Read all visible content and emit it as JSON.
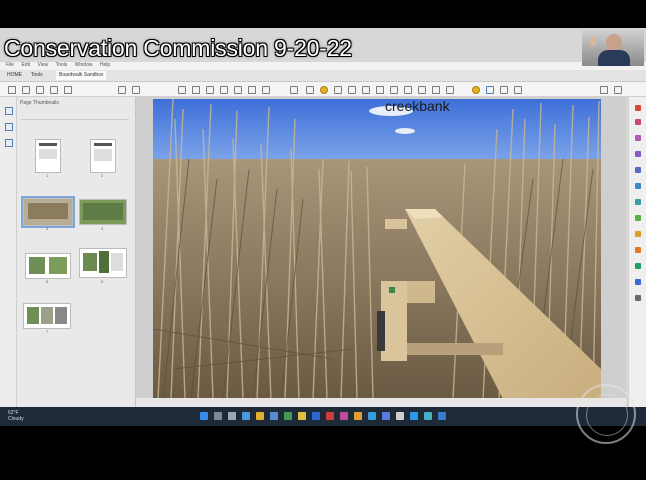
{
  "meeting": {
    "title": "Conservation Commission 9-20-22"
  },
  "app": {
    "menu": [
      "File",
      "Edit",
      "View",
      "Tools",
      "Window",
      "Help"
    ],
    "tabs": [
      {
        "label": "HOME",
        "active": false
      },
      {
        "label": "Tools",
        "active": false
      },
      {
        "label": "Boardwalk Sandbox",
        "active": true
      }
    ],
    "thumbnail_panel": {
      "header": "Page Thumbnails",
      "page_numbers": [
        "1",
        "2",
        "3",
        "4",
        "5",
        "6",
        "7"
      ],
      "selected_page": 3
    }
  },
  "document": {
    "photo_label": "creekbank"
  },
  "taskbar": {
    "weather": "62°F",
    "weather_sub": "Cloudy"
  },
  "colors": {
    "accent": "#4a7fc0",
    "selection": "#7da7d9",
    "taskbar": "#1e2a38"
  },
  "icons": [
    "hand-icon",
    "zoom-icon",
    "highlight-icon",
    "comment-icon",
    "search-icon",
    "windows-start-icon"
  ]
}
